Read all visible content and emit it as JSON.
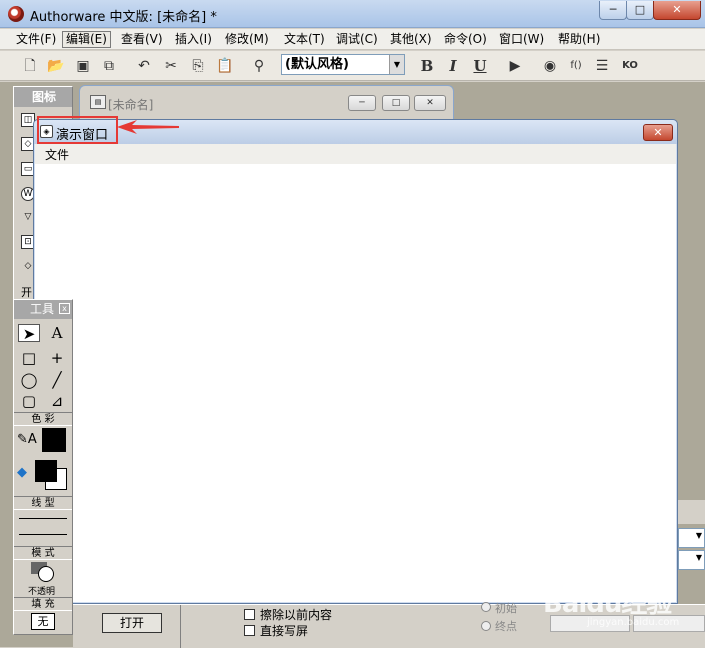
{
  "window": {
    "title": "Authorware 中文版: [未命名] *",
    "controls": {
      "minimize": "─",
      "maximize": "□",
      "close": "✕"
    }
  },
  "menubar": {
    "items": [
      "文件(F)",
      "编辑(E)",
      "查看(V)",
      "插入(I)",
      "修改(M)",
      "文本(T)",
      "调试(C)",
      "其他(X)",
      "命令(O)",
      "窗口(W)",
      "帮助(H)"
    ],
    "active_index": 1
  },
  "toolbar": {
    "style_select": "(默认风格)",
    "bold": "B",
    "italic": "I",
    "underline": "U",
    "icons": [
      "new-icon",
      "open-icon",
      "save-all-icon",
      "import-icon",
      "undo-icon",
      "cut-icon",
      "copy-icon",
      "paste-icon",
      "find-icon",
      "run-icon",
      "control-panel-icon",
      "functions-icon",
      "variables-icon",
      "knowledge-objects-icon"
    ]
  },
  "icon_palette": {
    "title": "图标",
    "partial_label": "开"
  },
  "design_window": {
    "title": "[未命名]"
  },
  "presentation_window": {
    "title": "演示窗口",
    "menu_file": "文件",
    "close": "✕"
  },
  "tools_palette": {
    "title": "工具",
    "close": "☒",
    "section_color": "色 彩",
    "section_line": "线 型",
    "section_mode": "模 式",
    "mode_value": "不透明",
    "section_fill": "填 充",
    "fill_value": "无"
  },
  "bottom_panel": {
    "checkbox_erase": "擦除以前内容",
    "checkbox_direct": "直接写屏",
    "open_button": "打开",
    "radio_initial": "初始",
    "radio_end": "终点"
  },
  "watermark": {
    "text": "Baidu经验",
    "sub": "jingyan.baidu.com"
  },
  "colors": {
    "highlight": "#e53935",
    "workspace": "#aca899"
  }
}
